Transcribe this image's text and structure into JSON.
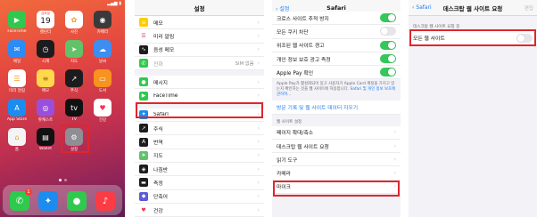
{
  "home": {
    "time": "",
    "apps": [
      {
        "label": "FaceTime",
        "icon": "facetime-icon",
        "color": "#2fc94e"
      },
      {
        "label": "캘린더",
        "icon": "calendar-icon",
        "color": "#ffffff",
        "day": "19",
        "weekday": "금요일"
      },
      {
        "label": "사진",
        "icon": "photos-icon",
        "color": "#ffffff"
      },
      {
        "label": "카메라",
        "icon": "camera-icon",
        "color": "#3a3a3c"
      },
      {
        "label": "메일",
        "icon": "mail-icon",
        "color": "#2c8bf5"
      },
      {
        "label": "시계",
        "icon": "clock-icon",
        "color": "#1c1c1e"
      },
      {
        "label": "지도",
        "icon": "maps-icon",
        "color": "#61c26a"
      },
      {
        "label": "날씨",
        "icon": "weather-icon",
        "color": "#3d8ef0"
      },
      {
        "label": "미리 알림",
        "icon": "reminders-icon",
        "color": "#ffffff"
      },
      {
        "label": "메모",
        "icon": "notes-icon",
        "color": "#ffd84d"
      },
      {
        "label": "주식",
        "icon": "stocks-icon",
        "color": "#1c1c1e"
      },
      {
        "label": "도서",
        "icon": "books-icon",
        "color": "#f7931e"
      },
      {
        "label": "App Store",
        "icon": "appstore-icon",
        "color": "#1b8cf0"
      },
      {
        "label": "팟캐스트",
        "icon": "podcasts-icon",
        "color": "#9a4fdc"
      },
      {
        "label": "TV",
        "icon": "tv-icon",
        "color": "#111111"
      },
      {
        "label": "건강",
        "icon": "health-icon",
        "color": "#ffffff"
      },
      {
        "label": "홈",
        "icon": "home-icon",
        "color": "#f4f4f4"
      },
      {
        "label": "Wallet",
        "icon": "wallet-icon",
        "color": "#111111"
      },
      {
        "label": "설정",
        "icon": "settings-icon",
        "color": "#8e8e93"
      }
    ],
    "tv_text": "tv",
    "dock": [
      {
        "icon": "phone-icon",
        "color": "#2fc94e",
        "badge": "1"
      },
      {
        "icon": "safari-icon",
        "color": "#1b8cf0"
      },
      {
        "icon": "messages-icon",
        "color": "#2fc94e"
      },
      {
        "icon": "music-icon",
        "color": "#fc3c44"
      }
    ]
  },
  "settings": {
    "title": "설정",
    "rows": [
      {
        "label": "메모",
        "color": "#ffcc00",
        "icon": "notes-icon"
      },
      {
        "label": "미리 알림",
        "color": "#ffffff",
        "icon": "reminders-icon"
      },
      {
        "label": "음성 메모",
        "color": "#1c1c1e",
        "icon": "voice-memos-icon"
      },
      {
        "label": "전화",
        "color": "#2fc94e",
        "icon": "phone-icon",
        "value": "SIM 없음",
        "disabled": true
      },
      {
        "label": "메시지",
        "color": "#2fc94e",
        "icon": "messages-icon"
      },
      {
        "label": "FaceTime",
        "color": "#2fc94e",
        "icon": "facetime-icon"
      },
      {
        "label": "Safari",
        "color": "#1b8cf0",
        "icon": "safari-icon"
      },
      {
        "label": "주식",
        "color": "#1c1c1e",
        "icon": "stocks-icon"
      },
      {
        "label": "번역",
        "color": "#1c1c1e",
        "icon": "translate-icon"
      },
      {
        "label": "지도",
        "color": "#61c26a",
        "icon": "maps-icon"
      },
      {
        "label": "나침반",
        "color": "#1c1c1e",
        "icon": "compass-icon"
      },
      {
        "label": "측정",
        "color": "#1c1c1e",
        "icon": "measure-icon"
      },
      {
        "label": "단축어",
        "color": "#5b5bd6",
        "icon": "shortcuts-icon"
      },
      {
        "label": "건강",
        "color": "#ffffff",
        "icon": "health-icon"
      }
    ]
  },
  "safari": {
    "back": "설정",
    "title": "Safari",
    "rows_top": [
      {
        "label": "크로스 사이트 추적 방지",
        "toggle": "on"
      },
      {
        "label": "모든 쿠키 차단",
        "toggle": "off"
      },
      {
        "label": "위조된 웹 사이트 경고",
        "toggle": "on"
      },
      {
        "label": "개인 정보 보호 광고 측정",
        "toggle": "on"
      },
      {
        "label": "Apple Pay 확인",
        "toggle": "on"
      }
    ],
    "note": "Apple Pay가 활성화되어 있고 사용자가 Apple Card 계정을 가지고 있는지 확인하는 것을 웹 사이트에 허용합니다.",
    "note_link": "Safari 및 개인 정보 보호에 관하여...",
    "clear_history": "방문 기록 및 웹 사이트 데이터 지우기",
    "section": "웹 사이트 설정",
    "rows_bottom": [
      "페이지 확대/축소",
      "데스크탑 웹 사이트 요청",
      "읽기 도구",
      "카메라",
      "마이크"
    ]
  },
  "desktop": {
    "back": "Safari",
    "title": "데스크탑 웹 사이트 요청",
    "edit": "편집",
    "section": "데스크탑 웹 사이트 요청 중",
    "row": "모든 웹 사이트",
    "toggle": "off"
  }
}
